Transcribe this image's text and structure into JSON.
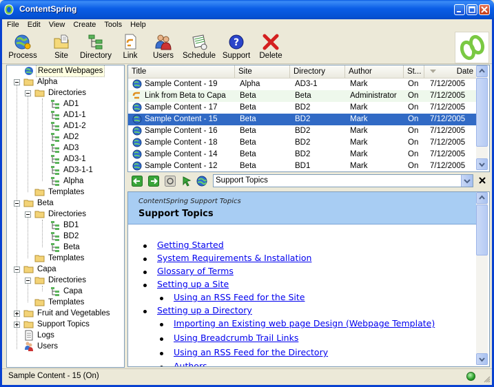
{
  "window": {
    "title": "ContentSpring"
  },
  "menu": [
    "File",
    "Edit",
    "View",
    "Create",
    "Tools",
    "Help"
  ],
  "toolbar": {
    "process": "Process",
    "site": "Site",
    "directory": "Directory",
    "link": "Link",
    "users": "Users",
    "schedule": "Schedule",
    "support": "Support",
    "delete": "Delete"
  },
  "tree": {
    "recent": "Recent Webpages",
    "alpha": "Alpha",
    "alpha_dirs": "Directories",
    "ad1": "AD1",
    "ad1_1": "AD1-1",
    "ad1_2": "AD1-2",
    "ad2": "AD2",
    "ad3": "AD3",
    "ad3_1": "AD3-1",
    "ad3_1_1": "AD3-1-1",
    "alpha_leaf": "Alpha",
    "alpha_templates": "Templates",
    "beta": "Beta",
    "beta_dirs": "Directories",
    "bd1": "BD1",
    "bd2": "BD2",
    "beta_leaf": "Beta",
    "beta_templates": "Templates",
    "capa": "Capa",
    "capa_dirs": "Directories",
    "capa_leaf": "Capa",
    "capa_templates": "Templates",
    "fruit": "Fruit and Vegetables",
    "support": "Support Topics",
    "logs": "Logs",
    "users": "Users"
  },
  "list": {
    "columns": {
      "title": "Title",
      "site": "Site",
      "directory": "Directory",
      "author": "Author",
      "status": "St...",
      "date": "Date"
    },
    "rows": [
      {
        "title": "Sample Content - 19",
        "site": "Alpha",
        "directory": "AD3-1",
        "author": "Mark",
        "status": "On",
        "date": "7/12/2005"
      },
      {
        "title": "Link from Beta to Capa",
        "site": "Beta",
        "directory": "Beta",
        "author": "Administrator",
        "status": "On",
        "date": "7/12/2005"
      },
      {
        "title": "Sample Content - 17",
        "site": "Beta",
        "directory": "BD2",
        "author": "Mark",
        "status": "On",
        "date": "7/12/2005"
      },
      {
        "title": "Sample Content - 15",
        "site": "Beta",
        "directory": "BD2",
        "author": "Mark",
        "status": "On",
        "date": "7/12/2005"
      },
      {
        "title": "Sample Content - 16",
        "site": "Beta",
        "directory": "BD2",
        "author": "Mark",
        "status": "On",
        "date": "7/12/2005"
      },
      {
        "title": "Sample Content - 18",
        "site": "Beta",
        "directory": "BD2",
        "author": "Mark",
        "status": "On",
        "date": "7/12/2005"
      },
      {
        "title": "Sample Content - 14",
        "site": "Beta",
        "directory": "BD2",
        "author": "Mark",
        "status": "On",
        "date": "7/12/2005"
      },
      {
        "title": "Sample Content - 12",
        "site": "Beta",
        "directory": "BD1",
        "author": "Mark",
        "status": "On",
        "date": "7/12/2005"
      }
    ]
  },
  "nav": {
    "address": "Support Topics"
  },
  "browser": {
    "header_sub": "ContentSpring Support Topics",
    "header_title": "Support Topics",
    "links": {
      "getting_started": "Getting Started",
      "sysreq": "System Requirements & Installation",
      "glossary": "Glossary of Terms",
      "setup_site": "Setting up a Site",
      "rss_site": "Using an RSS Feed for the Site",
      "setup_dir": "Setting up a Directory",
      "import_design": "Importing an Existing web page Design (Webpage Template)",
      "breadcrumb": "Using Breadcrumb Trail Links",
      "rss_dir": "Using an RSS Feed for the Directory",
      "authors": "Authors"
    }
  },
  "status": {
    "text": "Sample Content - 15 (On)"
  }
}
